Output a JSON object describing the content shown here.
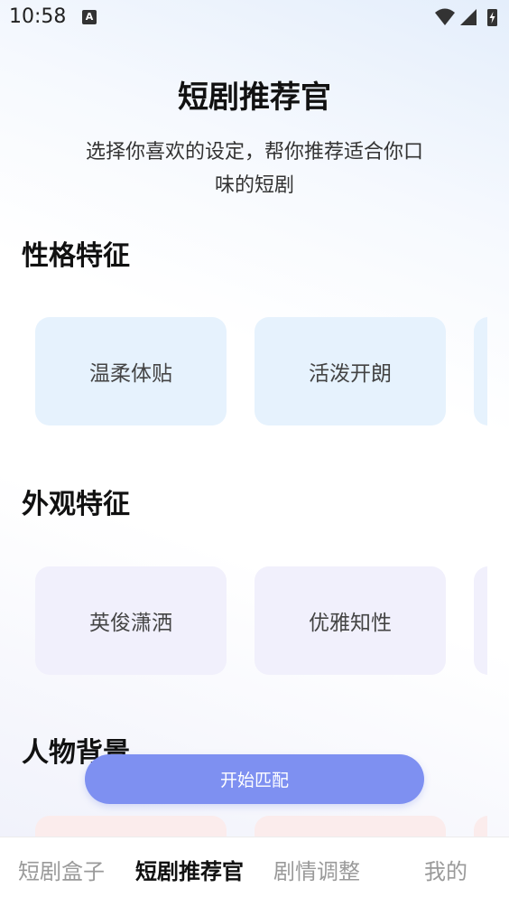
{
  "status_bar": {
    "time": "10:58",
    "notification_letter": "A"
  },
  "header": {
    "title": "短剧推荐官",
    "subtitle_line1": "选择你喜欢的设定，帮你推荐适合你口",
    "subtitle_line2": "味的短剧"
  },
  "sections": [
    {
      "title": "性格特征",
      "options": [
        "温柔体贴",
        "活泼开朗",
        ""
      ]
    },
    {
      "title": "外观特征",
      "options": [
        "英俊潇洒",
        "优雅知性",
        ""
      ]
    },
    {
      "title": "人物背景",
      "options": [
        "",
        "",
        ""
      ]
    }
  ],
  "match_button": {
    "label": "开始匹配"
  },
  "bottom_nav": {
    "items": [
      "短剧盒子",
      "短剧推荐官",
      "剧情调整",
      "我的"
    ],
    "active_index": 1
  },
  "colors": {
    "accent": "#7e90f1",
    "chip_personality": "#e6f2fd",
    "chip_appearance": "#f1f0fc",
    "chip_background": "#fbecec"
  }
}
